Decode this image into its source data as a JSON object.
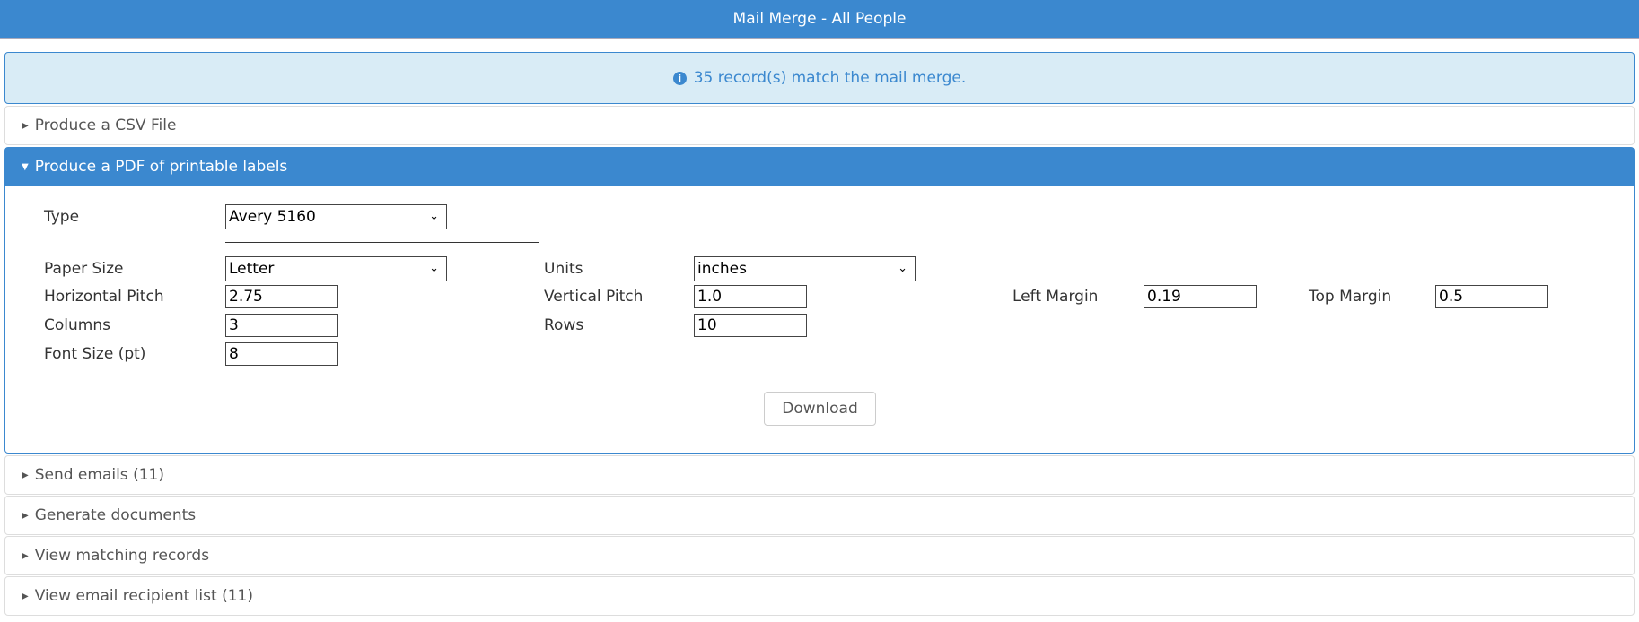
{
  "title": "Mail Merge - All People",
  "alert": {
    "icon": "info-icon",
    "text": "35 record(s) match the mail merge."
  },
  "panels": {
    "csv": "Produce a CSV File",
    "pdf": "Produce a PDF of printable labels",
    "emails": "Send emails (11)",
    "documents": "Generate documents",
    "records": "View matching records",
    "recipients": "View email recipient list (11)"
  },
  "form": {
    "type": {
      "label": "Type",
      "value": "Avery 5160"
    },
    "paper_size": {
      "label": "Paper Size",
      "value": "Letter"
    },
    "units": {
      "label": "Units",
      "value": "inches"
    },
    "horizontal_pitch": {
      "label": "Horizontal Pitch",
      "value": "2.75"
    },
    "vertical_pitch": {
      "label": "Vertical Pitch",
      "value": "1.0"
    },
    "left_margin": {
      "label": "Left Margin",
      "value": "0.19"
    },
    "top_margin": {
      "label": "Top Margin",
      "value": "0.5"
    },
    "columns": {
      "label": "Columns",
      "value": "3"
    },
    "rows": {
      "label": "Rows",
      "value": "10"
    },
    "font_size": {
      "label": "Font Size (pt)",
      "value": "8"
    },
    "download": "Download"
  }
}
